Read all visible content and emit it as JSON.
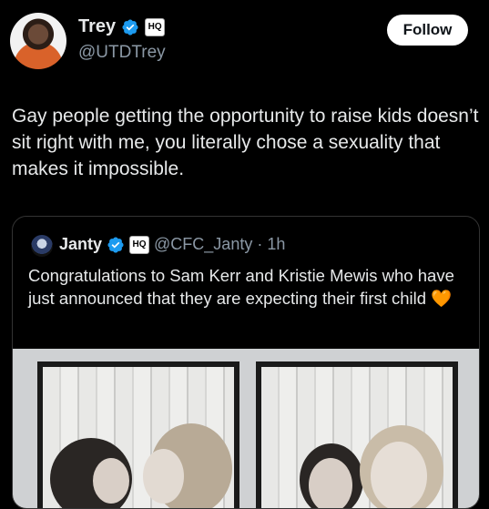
{
  "author": {
    "name": "Trey",
    "handle": "@UTDTrey",
    "badge_text": "HQ"
  },
  "follow_label": "Follow",
  "tweet_text": "Gay people getting the opportunity to raise kids doesn’t sit right with me, you literally chose a sexuality that makes it impossible.",
  "quoted": {
    "name": "Janty",
    "badge_text": "HQ",
    "handle": "@CFC_Janty",
    "separator": "·",
    "time": "1h",
    "text": "Congratulations to Sam Kerr and Kristie Mewis who have just announced that they are expecting their first child",
    "emoji": "🧡"
  },
  "colors": {
    "background": "#000000",
    "verified": "#1d9bf0",
    "secondary_text": "#8b98a5",
    "follow_bg": "#ffffff"
  },
  "icons": [
    "verified-badge-icon",
    "hq-badge-icon"
  ]
}
